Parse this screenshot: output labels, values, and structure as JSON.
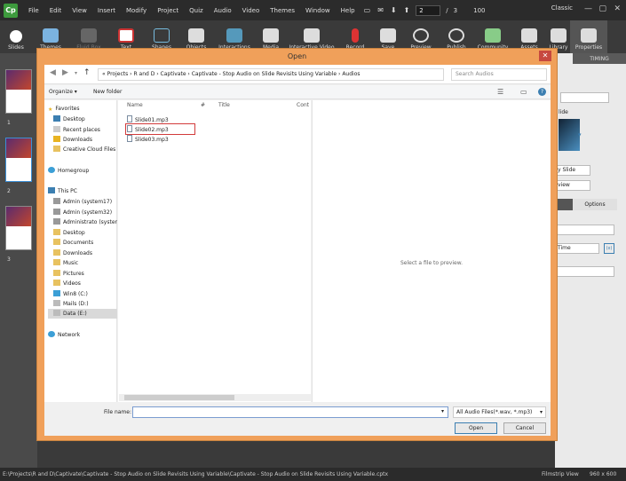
{
  "menubar": {
    "logo": "Cp",
    "menus": [
      "File",
      "Edit",
      "View",
      "Insert",
      "Modify",
      "Project",
      "Quiz",
      "Audio",
      "Video",
      "Themes",
      "Window",
      "Help"
    ],
    "page_current": "2",
    "page_sep": "/",
    "page_total": "3",
    "zoom": "100",
    "workspace": "Classic"
  },
  "ribbon": {
    "items": [
      "Slides",
      "Themes",
      "Fluid Box",
      "Text",
      "Shapes",
      "Objects",
      "Interactions",
      "Media",
      "Interactive Video",
      "Record",
      "Save",
      "Preview",
      "Publish",
      "Community",
      "Assets",
      "Library",
      "Properties"
    ]
  },
  "filmstrip": {
    "numbers": [
      "1",
      "2",
      "3"
    ]
  },
  "right_panel": {
    "timing_tab": "TIMING",
    "slide_label": "lide",
    "btn1": "y Slide",
    "btn2": "view",
    "options_tab": "Options",
    "time_label": "Time"
  },
  "dialog": {
    "title": "Open",
    "close": "✕",
    "address": "« Projects › R and D › Captivate › Captivate - Stop Audio on Slide Revisits Using Variable › Audios",
    "search_placeholder": "Search Audios",
    "organize": "Organize ▾",
    "new_folder": "New folder",
    "nav": [
      {
        "label": "Favorites"
      },
      {
        "label": "Desktop"
      },
      {
        "label": "Recent places"
      },
      {
        "label": "Downloads"
      },
      {
        "label": "Creative Cloud Files"
      },
      {
        "label": "Homegroup"
      },
      {
        "label": "This PC"
      },
      {
        "label": "Admin (system17)"
      },
      {
        "label": "Admin (system32)"
      },
      {
        "label": "Administrato (syster"
      },
      {
        "label": "Desktop"
      },
      {
        "label": "Documents"
      },
      {
        "label": "Downloads"
      },
      {
        "label": "Music"
      },
      {
        "label": "Pictures"
      },
      {
        "label": "Videos"
      },
      {
        "label": "Win8 (C:)"
      },
      {
        "label": "Mails (D:)"
      },
      {
        "label": "Data (E:)"
      },
      {
        "label": "Network"
      }
    ],
    "columns": [
      "Name",
      "#",
      "Title",
      "Cont"
    ],
    "files": [
      "Slide01.mp3",
      "Slide02.mp3",
      "Slide03.mp3"
    ],
    "preview_text": "Select a file to preview.",
    "file_name_label": "File name:",
    "file_name_value": "",
    "filter": "All Audio Files(*.wav, *.mp3)",
    "open_button": "Open",
    "cancel_button": "Cancel"
  },
  "status": {
    "path": "E:\\Projects\\R and D\\Captivate\\Captivate - Stop Audio on Slide Revisits Using Variable\\Captivate - Stop Audio on Slide Revisits Using Variable.cptx",
    "view": "Filmstrip View",
    "size": "960 x 600"
  }
}
